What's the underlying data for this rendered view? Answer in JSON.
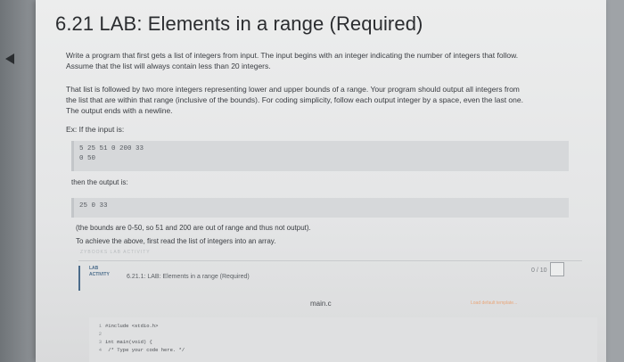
{
  "title": "6.21 LAB: Elements in a range (Required)",
  "paragraph1": [
    "Write a program that first gets a list of integers from input. The input begins with an integer indicating the number of integers that follow.",
    "Assume that the list will always contain less than 20 integers."
  ],
  "paragraph2": [
    "That list is followed by two more integers representing lower and upper bounds of a range. Your program should output all integers from",
    "the list that are within that range (inclusive of the bounds). For coding simplicity, follow each output integer by a space, even the last one.",
    "The output ends with a newline."
  ],
  "example_label": "Ex: If the input is:",
  "input_example": [
    "5 25 51 0 200 33",
    "0 50"
  ],
  "then_label": "then the output is:",
  "output_example": [
    "25 0 33"
  ],
  "note1": "(the bounds are 0-50, so 51 and 200 are out of range and thus not output).",
  "note2": "To achieve the above, first read the list of integers into an array.",
  "shadow_text": "ZYBOOKS  LAB  ACTIVITY",
  "lab_activity": {
    "badge_line1": "LAB",
    "badge_line2": "ACTIVITY",
    "title": "6.21.1: LAB: Elements in a range (Required)",
    "score": "0 / 10"
  },
  "file_name": "main.c",
  "load_default_template": "Load default template...",
  "editor_lines": [
    {
      "num": "1",
      "code": "#include <stdio.h>"
    },
    {
      "num": "2",
      "code": ""
    },
    {
      "num": "3",
      "code": "int main(void) {"
    },
    {
      "num": "4",
      "code": "   /* Type your code here. */"
    }
  ]
}
